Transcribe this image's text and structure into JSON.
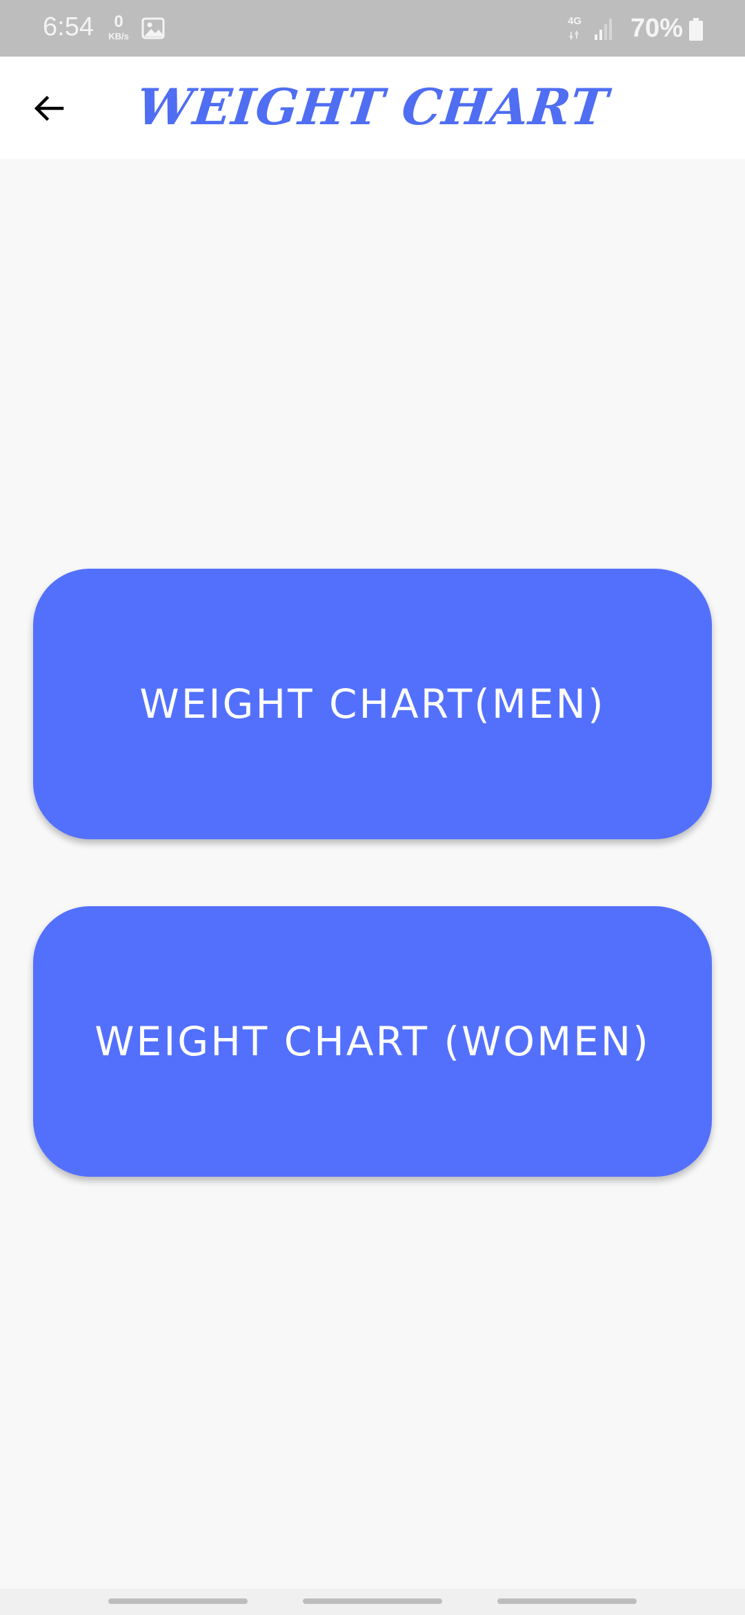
{
  "status_bar": {
    "time": "6:54",
    "data_speed_value": "0",
    "data_speed_unit": "KB/s",
    "network_type": "4G",
    "battery_percent": "70%",
    "icons": [
      "gallery-icon",
      "signal-icon",
      "battery-icon"
    ]
  },
  "app_bar": {
    "title": "WEIGHT CHART",
    "back_icon": "arrow-left-icon"
  },
  "buttons": {
    "men_label": "WEIGHT CHART(MEN)",
    "women_label": "WEIGHT CHART (WOMEN)"
  },
  "colors": {
    "accent": "#5370fd",
    "title": "#4f6ef2",
    "status_bar": "#bdbdbd",
    "background": "#f8f8f8"
  }
}
